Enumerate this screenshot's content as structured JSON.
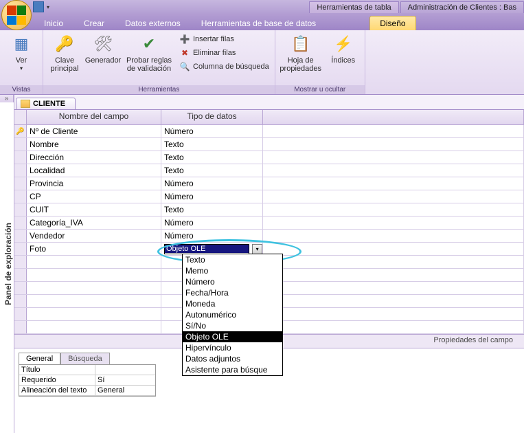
{
  "titlebar": {
    "context_tab": "Herramientas de tabla",
    "title": "Administración de Clientes : Bas"
  },
  "ribbon_tabs": [
    "Inicio",
    "Crear",
    "Datos externos",
    "Herramientas de base de datos",
    "Diseño"
  ],
  "ribbon_active_index": 4,
  "groups": {
    "vistas": {
      "label": "Vistas",
      "ver": "Ver"
    },
    "herramientas": {
      "label": "Herramientas",
      "clave": "Clave principal",
      "generador": "Generador",
      "probar": "Probar reglas de validación",
      "insertar": "Insertar filas",
      "eliminar": "Eliminar filas",
      "columna": "Columna de búsqueda"
    },
    "mostrar": {
      "label": "Mostrar u ocultar",
      "hoja": "Hoja de propiedades",
      "indices": "Índices"
    }
  },
  "nav_panel_label": "Panel de exploración",
  "nav_toggle": "»",
  "doc_tab": "CLIENTE",
  "grid": {
    "col_name": "Nombre del campo",
    "col_type": "Tipo de datos",
    "rows": [
      {
        "pk": true,
        "name": "Nº de Cliente",
        "type": "Número"
      },
      {
        "pk": false,
        "name": "Nombre",
        "type": "Texto"
      },
      {
        "pk": false,
        "name": "Dirección",
        "type": "Texto"
      },
      {
        "pk": false,
        "name": "Localidad",
        "type": "Texto"
      },
      {
        "pk": false,
        "name": "Provincia",
        "type": "Número"
      },
      {
        "pk": false,
        "name": "CP",
        "type": "Número"
      },
      {
        "pk": false,
        "name": "CUIT",
        "type": "Texto"
      },
      {
        "pk": false,
        "name": "Categoría_IVA",
        "type": "Número"
      },
      {
        "pk": false,
        "name": "Vendedor",
        "type": "Número"
      },
      {
        "pk": false,
        "name": "Foto",
        "type": "Objeto OLE",
        "dropdown": true
      }
    ]
  },
  "dropdown": {
    "selected": "Objeto OLE",
    "options": [
      "Texto",
      "Memo",
      "Número",
      "Fecha/Hora",
      "Moneda",
      "Autonumérico",
      "Sí/No",
      "Objeto OLE",
      "Hipervínculo",
      "Datos adjuntos",
      "Asistente para búsque"
    ]
  },
  "prop_strip": "Propiedades del campo",
  "prop_tabs": [
    "General",
    "Búsqueda"
  ],
  "prop_rows": [
    {
      "label": "Título",
      "value": ""
    },
    {
      "label": "Requerido",
      "value": "Sí"
    },
    {
      "label": "Alineación del texto",
      "value": "General"
    }
  ]
}
